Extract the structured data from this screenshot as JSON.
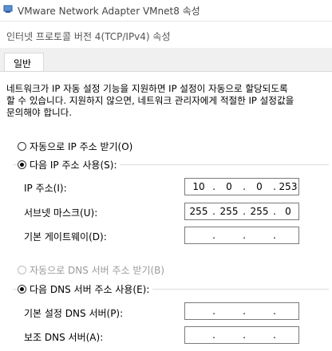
{
  "outer_window": {
    "title": "VMware Network Adapter VMnet8 속성",
    "icon": "network-adapter-icon"
  },
  "dialog": {
    "title": "인터넷 프로토콜 버전 4(TCP/IPv4) 속성",
    "tab": "일반",
    "description_line1": "네트워크가 IP 자동 설정 기능을 지원하면 IP 설정이 자동으로 할당되도록",
    "description_line2": "할 수 있습니다. 지원하지 않으면, 네트워크 관리자에게 적절한 IP 설정값을",
    "description_line3": "문의해야 합니다.",
    "ip_auto_label": "자동으로 IP 주소 받기(O)",
    "ip_manual_label": "다음 IP 주소 사용(S):",
    "ip_mode_selected": "manual",
    "fields": {
      "ip_address": {
        "label": "IP 주소(I):",
        "octets": [
          "10",
          "0",
          "0",
          "253"
        ]
      },
      "subnet_mask": {
        "label": "서브넷 마스크(U):",
        "octets": [
          "255",
          "255",
          "255",
          "0"
        ]
      },
      "default_gateway": {
        "label": "기본 게이트웨이(D):",
        "octets": [
          "",
          "",
          "",
          ""
        ]
      }
    },
    "dns_auto_label": "자동으로 DNS 서버 주소 받기(B)",
    "dns_auto_disabled": true,
    "dns_manual_label": "다음 DNS 서버 주소 사용(E):",
    "dns_mode_selected": "manual",
    "dns_fields": {
      "preferred": {
        "label": "기본 설정 DNS 서버(P):",
        "octets": [
          "",
          "",
          "",
          ""
        ]
      },
      "alternate": {
        "label": "보조 DNS 서버(A):",
        "octets": [
          "",
          "",
          "",
          ""
        ]
      }
    },
    "dot": "."
  }
}
